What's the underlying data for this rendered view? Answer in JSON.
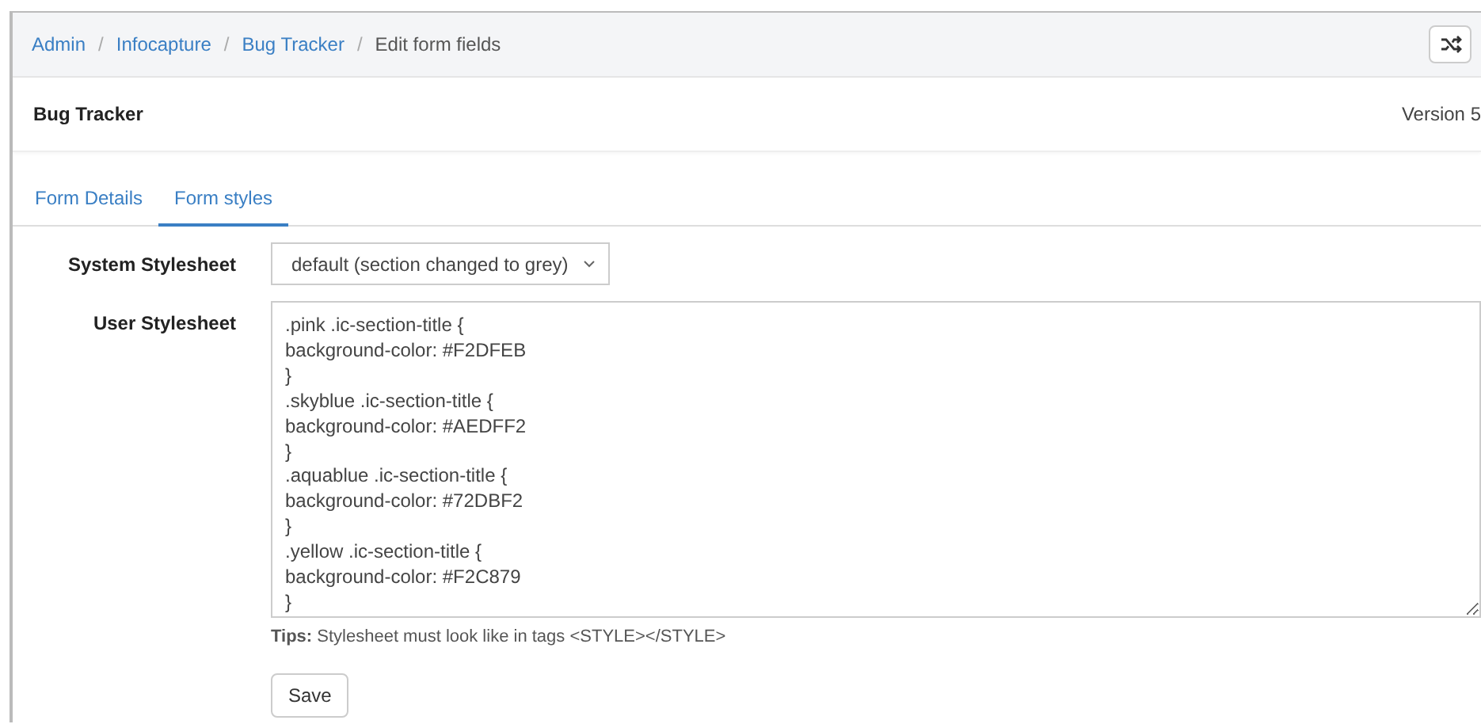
{
  "breadcrumb": [
    {
      "label": "Admin",
      "link": true
    },
    {
      "separator": "/",
      "label": "Infocapture",
      "link": true
    },
    {
      "separator": "/",
      "label": "Bug Tracker",
      "link": true
    },
    {
      "separator": "/",
      "label": "Edit form fields",
      "link": false
    }
  ],
  "header": {
    "title": "Bug Tracker",
    "version": "Version 5"
  },
  "tabs": [
    {
      "label": "Form Details",
      "selected": false
    },
    {
      "label": "Form styles",
      "selected": true
    }
  ],
  "system_stylesheet": {
    "label": "System Stylesheet",
    "value": "default (section changed to grey)"
  },
  "user_stylesheet": {
    "label": "User Stylesheet",
    "lines": [
      ".pink .ic-section-title {",
      "background-color: #F2DFEB",
      "}",
      ".skyblue .ic-section-title {",
      "background-color: #AEDFF2",
      "}",
      ".aquablue .ic-section-title {",
      "background-color: #72DBF2",
      "}",
      ".yellow .ic-section-title {",
      "background-color: #F2C879",
      "}"
    ]
  },
  "tips": {
    "label": "Tips:",
    "text": "Stylesheet must look like in tags <STYLE></STYLE>"
  },
  "buttons": [
    "Save"
  ]
}
